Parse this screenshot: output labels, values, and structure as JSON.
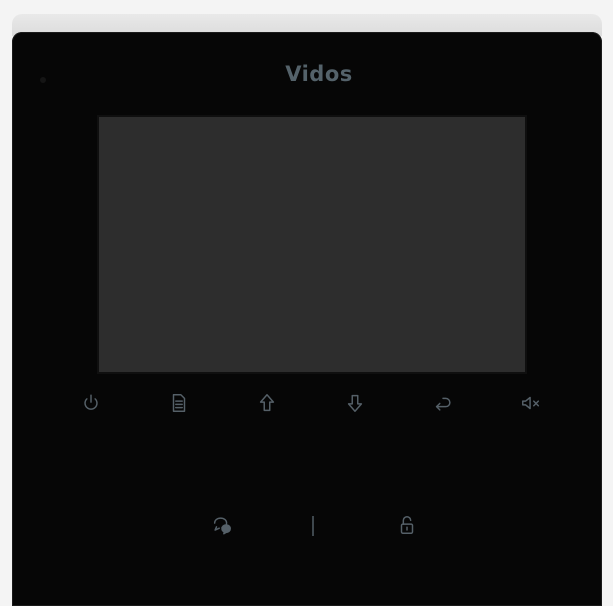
{
  "device": {
    "brand": "Vidos",
    "accent_color": "#556068",
    "screen_color": "#2d2d2d"
  },
  "top_keys": [
    {
      "icon": "power-icon"
    },
    {
      "icon": "menu-document-icon"
    },
    {
      "icon": "arrow-up-icon"
    },
    {
      "icon": "arrow-down-icon"
    },
    {
      "icon": "return-icon"
    },
    {
      "icon": "mute-icon"
    }
  ],
  "bottom_keys": [
    {
      "icon": "intercom-chat-icon"
    },
    {
      "icon": "unlock-icon"
    }
  ]
}
